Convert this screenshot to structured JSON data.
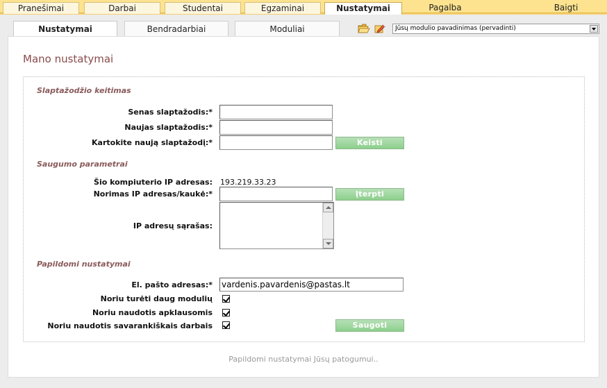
{
  "top_nav": {
    "tabs": [
      "Pranešimai",
      "Darbai",
      "Studentai",
      "Egzaminai",
      "Nustatymai"
    ],
    "active": "Nustatymai",
    "help": "Pagalba",
    "logout": "Baigti"
  },
  "sub_nav": {
    "tabs": [
      "Nustatymai",
      "Bendradarbiai",
      "Moduliai"
    ],
    "active": "Nustatymai",
    "module_select": "Jūsų modulio pavadinimas (pervadinti)"
  },
  "page": {
    "title": "Mano nustatymai"
  },
  "password_section": {
    "heading": "Slaptažodžio keitimas",
    "old_label": "Senas slaptažodis:*",
    "new_label": "Naujas slaptažodis:*",
    "repeat_label": "Kartokite naują slaptažodį:*",
    "change_button": "Keisti"
  },
  "security_section": {
    "heading": "Saugumo parametrai",
    "ip_label": "Šio kompiuterio IP adresas:",
    "ip_value": "193.219.33.23",
    "wanted_ip_label": "Norimas IP adresas/kaukė:*",
    "insert_button": "Įterpti",
    "ip_list_label": "IP adresų sąrašas:"
  },
  "extra_section": {
    "heading": "Papildomi nustatymai",
    "email_label": "El. pašto adresas:*",
    "email_value": "vardenis.pavardenis@pastas.lt",
    "opt_modules_label": "Noriu turėti daug modulių",
    "opt_modules": true,
    "opt_surveys_label": "Noriu naudotis apklausomis",
    "opt_surveys": true,
    "opt_selfwork_label": "Noriu naudotis savarankiškais darbais",
    "opt_selfwork": true,
    "save_button": "Saugoti"
  },
  "footer": {
    "text": "Papildomi nustatymai Jūsų patogumui.."
  }
}
